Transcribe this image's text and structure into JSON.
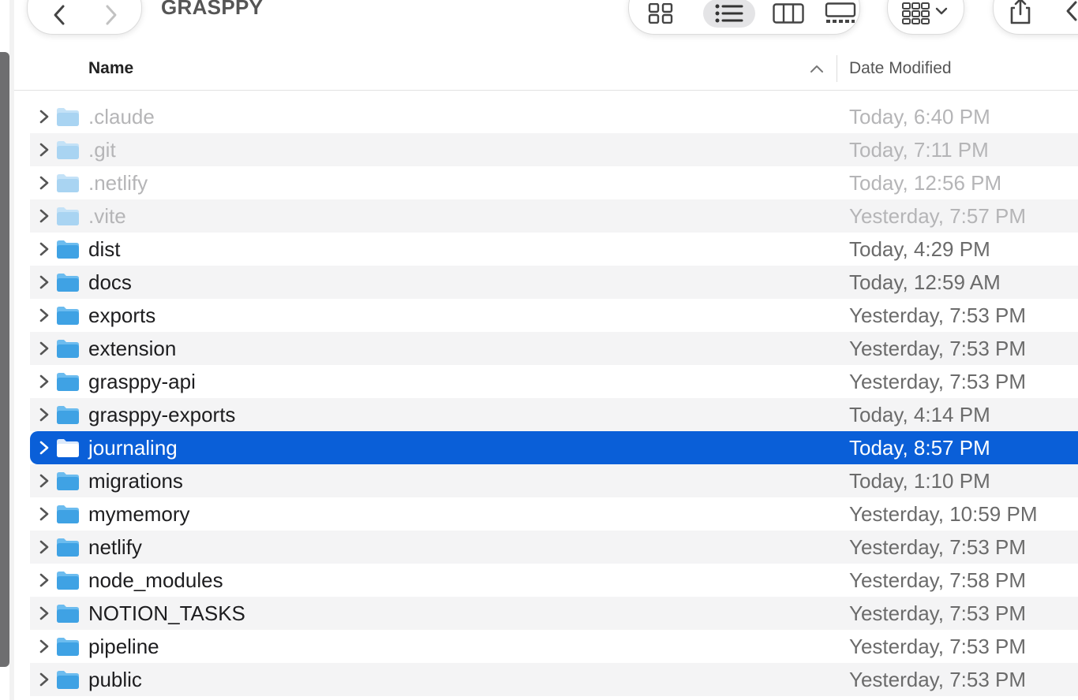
{
  "window": {
    "title": "GRASPPY"
  },
  "toolbar": {
    "nav": {
      "back_icon": "chevron-left-icon",
      "forward_icon": "chevron-right-icon"
    },
    "views": [
      {
        "name": "icon-view-icon"
      },
      {
        "name": "list-view-icon",
        "active": true
      },
      {
        "name": "column-view-icon"
      },
      {
        "name": "gallery-view-icon"
      }
    ],
    "group_icon": "group-grid-icon",
    "share_icon": "share-icon"
  },
  "columns": {
    "name": "Name",
    "date": "Date Modified"
  },
  "colors": {
    "selection": "#0a5fd8",
    "folder": "#3fa2e4",
    "hidden_folder": "#a9d4f2"
  },
  "files": [
    {
      "name": ".claude",
      "date": "Today, 6:40 PM",
      "hidden": true
    },
    {
      "name": ".git",
      "date": "Today, 7:11 PM",
      "hidden": true
    },
    {
      "name": ".netlify",
      "date": "Today, 12:56 PM",
      "hidden": true
    },
    {
      "name": ".vite",
      "date": "Yesterday, 7:57 PM",
      "hidden": true
    },
    {
      "name": "dist",
      "date": "Today, 4:29 PM"
    },
    {
      "name": "docs",
      "date": "Today, 12:59 AM"
    },
    {
      "name": "exports",
      "date": "Yesterday, 7:53 PM"
    },
    {
      "name": "extension",
      "date": "Yesterday, 7:53 PM"
    },
    {
      "name": "grasppy-api",
      "date": "Yesterday, 7:53 PM"
    },
    {
      "name": "grasppy-exports",
      "date": "Today, 4:14 PM"
    },
    {
      "name": "journaling",
      "date": "Today, 8:57 PM",
      "selected": true
    },
    {
      "name": "migrations",
      "date": "Today, 1:10 PM"
    },
    {
      "name": "mymemory",
      "date": "Yesterday, 10:59 PM"
    },
    {
      "name": "netlify",
      "date": "Yesterday, 7:53 PM"
    },
    {
      "name": "node_modules",
      "date": "Yesterday, 7:58 PM"
    },
    {
      "name": "NOTION_TASKS",
      "date": "Yesterday, 7:53 PM"
    },
    {
      "name": "pipeline",
      "date": "Yesterday, 7:53 PM"
    },
    {
      "name": "public",
      "date": "Yesterday, 7:53 PM"
    }
  ]
}
